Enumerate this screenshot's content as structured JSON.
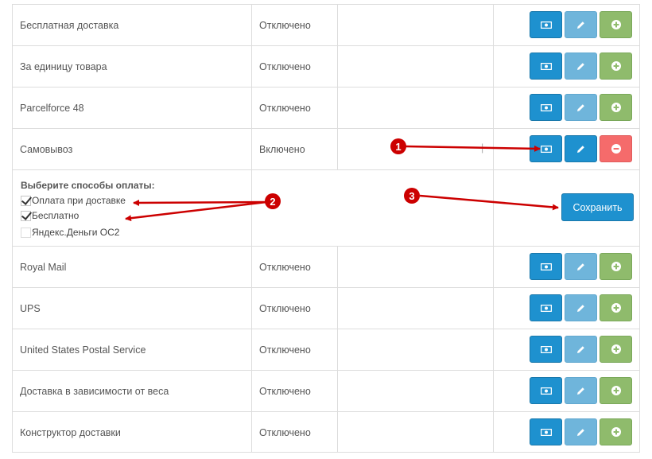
{
  "rows_top": [
    {
      "name": "Бесплатная доставка",
      "status": "Отключено"
    },
    {
      "name": "За единицу товара",
      "status": "Отключено"
    },
    {
      "name": "Parcelforce 48",
      "status": "Отключено"
    }
  ],
  "selected_row": {
    "name": "Самовывоз",
    "status": "Включено",
    "cell_mark": "|"
  },
  "payment": {
    "heading": "Выберите способы оплаты:",
    "options": [
      {
        "label": "Оплата при доставке",
        "checked": true
      },
      {
        "label": "Бесплатно",
        "checked": true
      },
      {
        "label": "Яндекс.Деньги ОС2",
        "checked": false
      }
    ],
    "save_label": "Сохранить"
  },
  "rows_bottom": [
    {
      "name": "Royal Mail",
      "status": "Отключено"
    },
    {
      "name": "UPS",
      "status": "Отключено"
    },
    {
      "name": "United States Postal Service",
      "status": "Отключено"
    },
    {
      "name": "Доставка в зависимости от веса",
      "status": "Отключено"
    },
    {
      "name": "Конструктор доставки",
      "status": "Отключено"
    }
  ],
  "annotations": {
    "a1": "1",
    "a2": "2",
    "a3": "3"
  },
  "icons": {
    "info": "money-icon",
    "edit": "pencil-icon",
    "add": "plus-circle-icon",
    "remove": "minus-circle-icon"
  },
  "colors": {
    "primary": "#1e91cf",
    "primary_disabled": "#6fb5db",
    "success": "#8fbb6c",
    "danger": "#f56b6b",
    "annotation": "#cc0000"
  }
}
